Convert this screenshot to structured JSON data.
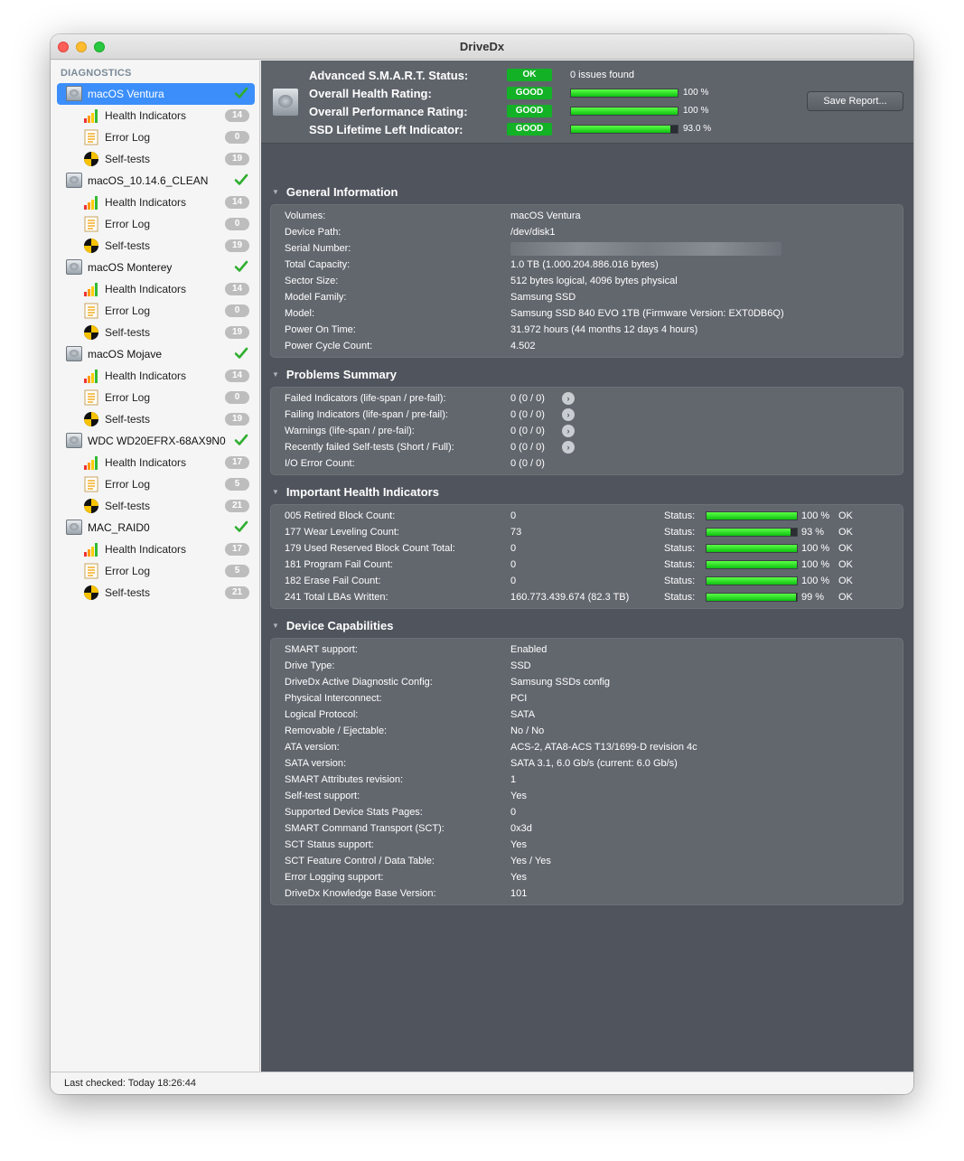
{
  "window": {
    "title": "DriveDx"
  },
  "sidebar": {
    "header": "DIAGNOSTICS",
    "disks": [
      {
        "name": "macOS Ventura",
        "selected": true,
        "health": 14,
        "errors": 0,
        "selftests": 19
      },
      {
        "name": "macOS_10.14.6_CLEAN",
        "selected": false,
        "health": 14,
        "errors": 0,
        "selftests": 19
      },
      {
        "name": "macOS Monterey",
        "selected": false,
        "health": 14,
        "errors": 0,
        "selftests": 19
      },
      {
        "name": "macOS Mojave",
        "selected": false,
        "health": 14,
        "errors": 0,
        "selftests": 19
      },
      {
        "name": "WDC WD20EFRX-68AX9N0",
        "selected": false,
        "health": 17,
        "errors": 5,
        "selftests": 21
      },
      {
        "name": "MAC_RAID0",
        "selected": false,
        "health": 17,
        "errors": 5,
        "selftests": 21
      }
    ],
    "sub_labels": {
      "health": "Health Indicators",
      "errors": "Error Log",
      "selftests": "Self-tests"
    }
  },
  "summary": {
    "smart_status_label": "Advanced S.M.A.R.T. Status:",
    "smart_status_pill": "OK",
    "smart_status_text": "0 issues found",
    "health_label": "Overall Health Rating:",
    "health_pill": "GOOD",
    "health_pct": 100,
    "health_text": "100 %",
    "perf_label": "Overall Performance Rating:",
    "perf_pill": "GOOD",
    "perf_pct": 100,
    "perf_text": "100 %",
    "ssd_label": "SSD Lifetime Left Indicator:",
    "ssd_pill": "GOOD",
    "ssd_pct": 93,
    "ssd_text": "93.0 %",
    "save_button": "Save Report..."
  },
  "general": {
    "title": "General Information",
    "rows": [
      {
        "k": "Volumes:",
        "v": "macOS Ventura"
      },
      {
        "k": "Device Path:",
        "v": "/dev/disk1"
      },
      {
        "k": "Serial Number:",
        "v": ""
      },
      {
        "k": "Total Capacity:",
        "v": "1.0 TB (1.000.204.886.016 bytes)"
      },
      {
        "k": "Sector Size:",
        "v": "512 bytes logical, 4096 bytes physical"
      },
      {
        "k": "Model Family:",
        "v": "Samsung SSD"
      },
      {
        "k": "Model:",
        "v": "Samsung SSD 840 EVO 1TB  (Firmware Version: EXT0DB6Q)"
      },
      {
        "k": "Power On Time:",
        "v": "31.972 hours (44 months 12 days 4 hours)"
      },
      {
        "k": "Power Cycle Count:",
        "v": "4.502"
      }
    ]
  },
  "problems": {
    "title": "Problems Summary",
    "rows": [
      {
        "k": "Failed Indicators (life-span / pre-fail):",
        "v": "0 (0 / 0)",
        "arrow": true
      },
      {
        "k": "Failing Indicators (life-span / pre-fail):",
        "v": "0 (0 / 0)",
        "arrow": true
      },
      {
        "k": "Warnings (life-span / pre-fail):",
        "v": "0 (0 / 0)",
        "arrow": true
      },
      {
        "k": "Recently failed Self-tests (Short / Full):",
        "v": "0 (0 / 0)",
        "arrow": true
      },
      {
        "k": "I/O Error Count:",
        "v": "0 (0 / 0)",
        "arrow": false
      }
    ]
  },
  "health": {
    "title": "Important Health Indicators",
    "status_label": "Status:",
    "rows": [
      {
        "k": "005  Retired Block Count:",
        "v": "0",
        "pct": 100,
        "pct_text": "100 %",
        "ok": "OK"
      },
      {
        "k": "177  Wear Leveling Count:",
        "v": "73",
        "pct": 93,
        "pct_text": "93 %",
        "ok": "OK"
      },
      {
        "k": "179  Used Reserved Block Count Total:",
        "v": "0",
        "pct": 100,
        "pct_text": "100 %",
        "ok": "OK"
      },
      {
        "k": "181  Program Fail Count:",
        "v": "0",
        "pct": 100,
        "pct_text": "100 %",
        "ok": "OK"
      },
      {
        "k": "182  Erase Fail Count:",
        "v": "0",
        "pct": 100,
        "pct_text": "100 %",
        "ok": "OK"
      },
      {
        "k": "241  Total LBAs Written:",
        "v": "160.773.439.674 (82.3 TB)",
        "pct": 99,
        "pct_text": "99 %",
        "ok": "OK"
      }
    ]
  },
  "capabilities": {
    "title": "Device Capabilities",
    "rows": [
      {
        "k": "SMART support:",
        "v": "Enabled"
      },
      {
        "k": "Drive Type:",
        "v": "SSD"
      },
      {
        "k": "DriveDx Active Diagnostic Config:",
        "v": "Samsung SSDs config"
      },
      {
        "k": "Physical Interconnect:",
        "v": "PCI"
      },
      {
        "k": "Logical Protocol:",
        "v": "SATA"
      },
      {
        "k": "Removable / Ejectable:",
        "v": "No / No"
      },
      {
        "k": "ATA version:",
        "v": "ACS-2, ATA8-ACS T13/1699-D revision 4c"
      },
      {
        "k": "SATA version:",
        "v": "SATA 3.1, 6.0 Gb/s (current: 6.0 Gb/s)"
      },
      {
        "k": "SMART Attributes revision:",
        "v": "1"
      },
      {
        "k": "Self-test support:",
        "v": "Yes"
      },
      {
        "k": "Supported Device Stats Pages:",
        "v": "0"
      },
      {
        "k": "SMART Command Transport (SCT):",
        "v": "0x3d"
      },
      {
        "k": "SCT Status support:",
        "v": "Yes"
      },
      {
        "k": "SCT Feature Control / Data Table:",
        "v": "Yes / Yes"
      },
      {
        "k": "Error Logging support:",
        "v": "Yes"
      },
      {
        "k": "DriveDx Knowledge Base Version:",
        "v": "101"
      }
    ]
  },
  "statusbar": {
    "text": "Last checked: Today 18:26:44"
  }
}
